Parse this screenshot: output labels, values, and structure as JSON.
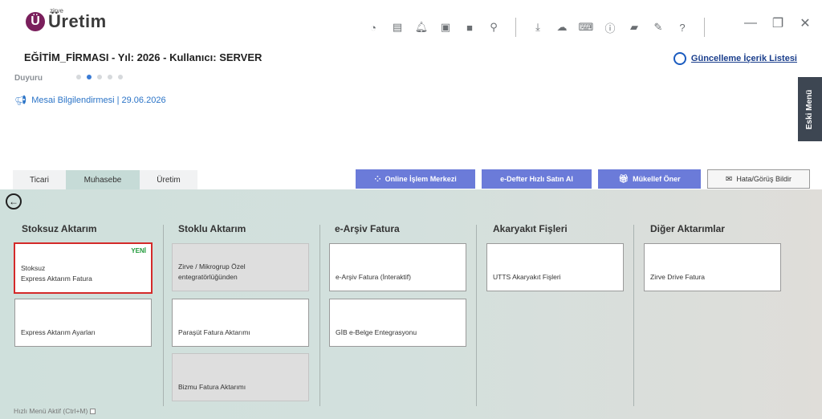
{
  "app": {
    "logo_small": "zirve",
    "logo_big": "Üretim"
  },
  "header": {
    "company_line": "EĞİTİM_FİRMASI - Yıl: 2026 - Kullanıcı: SERVER",
    "update_link": "Güncelleme İçerik Listesi",
    "duyuru_label": "Duyuru",
    "announcement": "Mesai Bilgilendirmesi | 29.06.2026",
    "eski_menu": "Eski Menü"
  },
  "toolbar": {
    "icons": [
      "pie-chart-icon",
      "panel-icon",
      "bell-icon",
      "money-icon",
      "save-icon",
      "location-pin-icon",
      "download-icon",
      "cloud-upload-icon",
      "keyboard-icon",
      "info-icon",
      "chat-icon",
      "edit-icon",
      "help-icon"
    ]
  },
  "tabs": [
    {
      "label": "Ticari"
    },
    {
      "label": "Muhasebe"
    },
    {
      "label": "Üretim"
    }
  ],
  "buttons": {
    "online": "Online İşlem Merkezi",
    "edefter": "e-Defter Hızlı Satın Al",
    "mukellef": "Mükellef Öner",
    "hata": "Hata/Görüş Bildir"
  },
  "sections": {
    "stoksuz": {
      "title": "Stoksuz Aktarım",
      "cards": [
        {
          "label_line1": "Stoksuz",
          "label_line2": "Express Aktarım Fatura",
          "badge": "YENİ"
        },
        {
          "label_line1": "Express Aktarım Ayarları"
        }
      ]
    },
    "stoklu": {
      "title": "Stoklu Aktarım",
      "cards": [
        {
          "label_line1": "Zirve / Mikrogrup Özel",
          "label_line2": "entegratörlüğünden"
        },
        {
          "label_line1": "Paraşüt Fatura Aktarımı"
        },
        {
          "label_line1": "Bizmu Fatura Aktarımı"
        }
      ]
    },
    "earsiv": {
      "title": "e-Arşiv Fatura",
      "cards": [
        {
          "label_line1": "e-Arşiv Fatura (İnteraktif)"
        },
        {
          "label_line1": "GİB e-Belge Entegrasyonu"
        }
      ]
    },
    "akaryakit": {
      "title": "Akaryakıt Fişleri",
      "cards": [
        {
          "label_line1": "UTTS Akaryakıt Fişleri"
        }
      ]
    },
    "diger": {
      "title": "Diğer Aktarımlar",
      "cards": [
        {
          "label_line1": "Zirve Drive Fatura"
        }
      ]
    }
  },
  "footer": {
    "hizli_menu": "Hızlı Menü Aktif (Ctrl+M)"
  },
  "colors": {
    "brand": "#7a1f5c",
    "accent_button": "#6b7bd9",
    "highlight_border": "#d42a2a",
    "badge_green": "#1f9a3a"
  }
}
